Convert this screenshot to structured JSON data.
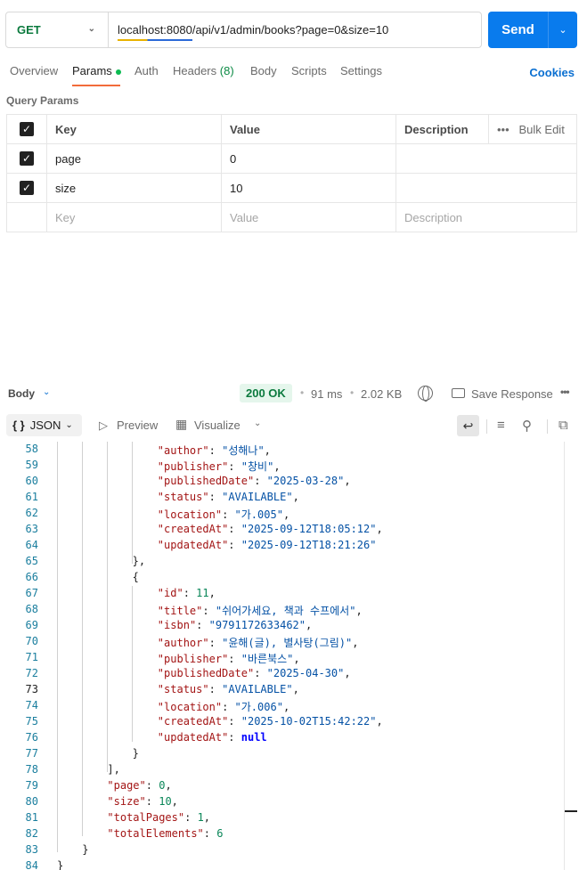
{
  "request": {
    "method": "GET",
    "url": "localhost:8080/api/v1/admin/books?page=0&size=10",
    "send_label": "Send"
  },
  "tabs": [
    {
      "label": "Overview"
    },
    {
      "label": "Params"
    },
    {
      "label": "Auth"
    },
    {
      "label": "Headers",
      "count": "(8)"
    },
    {
      "label": "Body"
    },
    {
      "label": "Scripts"
    },
    {
      "label": "Settings"
    }
  ],
  "cookies_label": "Cookies",
  "query_params": {
    "title": "Query Params",
    "headers": {
      "key": "Key",
      "value": "Value",
      "description": "Description",
      "bulk_edit": "Bulk Edit"
    },
    "rows": [
      {
        "key": "page",
        "value": "0",
        "checked": true
      },
      {
        "key": "size",
        "value": "10",
        "checked": true
      }
    ],
    "placeholders": {
      "key": "Key",
      "value": "Value",
      "description": "Description"
    }
  },
  "response": {
    "section_label": "Body",
    "status": "200 OK",
    "time": "91 ms",
    "size": "2.02 KB",
    "save_label": "Save Response"
  },
  "toolbar": {
    "format_icon": "{ }",
    "format_label": "JSON",
    "preview_label": "Preview",
    "visualize_label": "Visualize"
  },
  "code": [
    {
      "n": "58",
      "i": 8,
      "k": "author",
      "v": "성해나",
      "t": "s",
      "c": ","
    },
    {
      "n": "59",
      "i": 8,
      "k": "publisher",
      "v": "창비",
      "t": "s",
      "c": ","
    },
    {
      "n": "60",
      "i": 8,
      "k": "publishedDate",
      "v": "2025-03-28",
      "t": "s",
      "c": ","
    },
    {
      "n": "61",
      "i": 8,
      "k": "status",
      "v": "AVAILABLE",
      "t": "s",
      "c": ","
    },
    {
      "n": "62",
      "i": 8,
      "k": "location",
      "v": "가.005",
      "t": "s",
      "c": ","
    },
    {
      "n": "63",
      "i": 8,
      "k": "createdAt",
      "v": "2025-09-12T18:05:12",
      "t": "s",
      "c": ","
    },
    {
      "n": "64",
      "i": 8,
      "k": "updatedAt",
      "v": "2025-09-12T18:21:26",
      "t": "s",
      "c": ""
    },
    {
      "n": "65",
      "i": 6,
      "raw": "},"
    },
    {
      "n": "66",
      "i": 6,
      "raw": "{"
    },
    {
      "n": "67",
      "i": 8,
      "k": "id",
      "v": "11",
      "t": "n",
      "c": ","
    },
    {
      "n": "68",
      "i": 8,
      "k": "title",
      "v": "쉬어가세요, 책과 수프에서",
      "t": "s",
      "c": ","
    },
    {
      "n": "69",
      "i": 8,
      "k": "isbn",
      "v": "9791172633462",
      "t": "s",
      "c": ","
    },
    {
      "n": "70",
      "i": 8,
      "k": "author",
      "v": "윤해(글), 별사탕(그림)",
      "t": "s",
      "c": ","
    },
    {
      "n": "71",
      "i": 8,
      "k": "publisher",
      "v": "바른북스",
      "t": "s",
      "c": ","
    },
    {
      "n": "72",
      "i": 8,
      "k": "publishedDate",
      "v": "2025-04-30",
      "t": "s",
      "c": ","
    },
    {
      "n": "73",
      "i": 8,
      "k": "status",
      "v": "AVAILABLE",
      "t": "s",
      "c": ",",
      "cur": true
    },
    {
      "n": "74",
      "i": 8,
      "k": "location",
      "v": "가.006",
      "t": "s",
      "c": ","
    },
    {
      "n": "75",
      "i": 8,
      "k": "createdAt",
      "v": "2025-10-02T15:42:22",
      "t": "s",
      "c": ","
    },
    {
      "n": "76",
      "i": 8,
      "k": "updatedAt",
      "v": "null",
      "t": "kw",
      "c": ""
    },
    {
      "n": "77",
      "i": 6,
      "raw": "}"
    },
    {
      "n": "78",
      "i": 4,
      "raw": "],"
    },
    {
      "n": "79",
      "i": 4,
      "k": "page",
      "v": "0",
      "t": "n",
      "c": ","
    },
    {
      "n": "80",
      "i": 4,
      "k": "size",
      "v": "10",
      "t": "n",
      "c": ","
    },
    {
      "n": "81",
      "i": 4,
      "k": "totalPages",
      "v": "1",
      "t": "n",
      "c": ","
    },
    {
      "n": "82",
      "i": 4,
      "k": "totalElements",
      "v": "6",
      "t": "n",
      "c": ""
    },
    {
      "n": "83",
      "i": 2,
      "raw": "}"
    },
    {
      "n": "84",
      "i": 0,
      "raw": "}"
    }
  ]
}
